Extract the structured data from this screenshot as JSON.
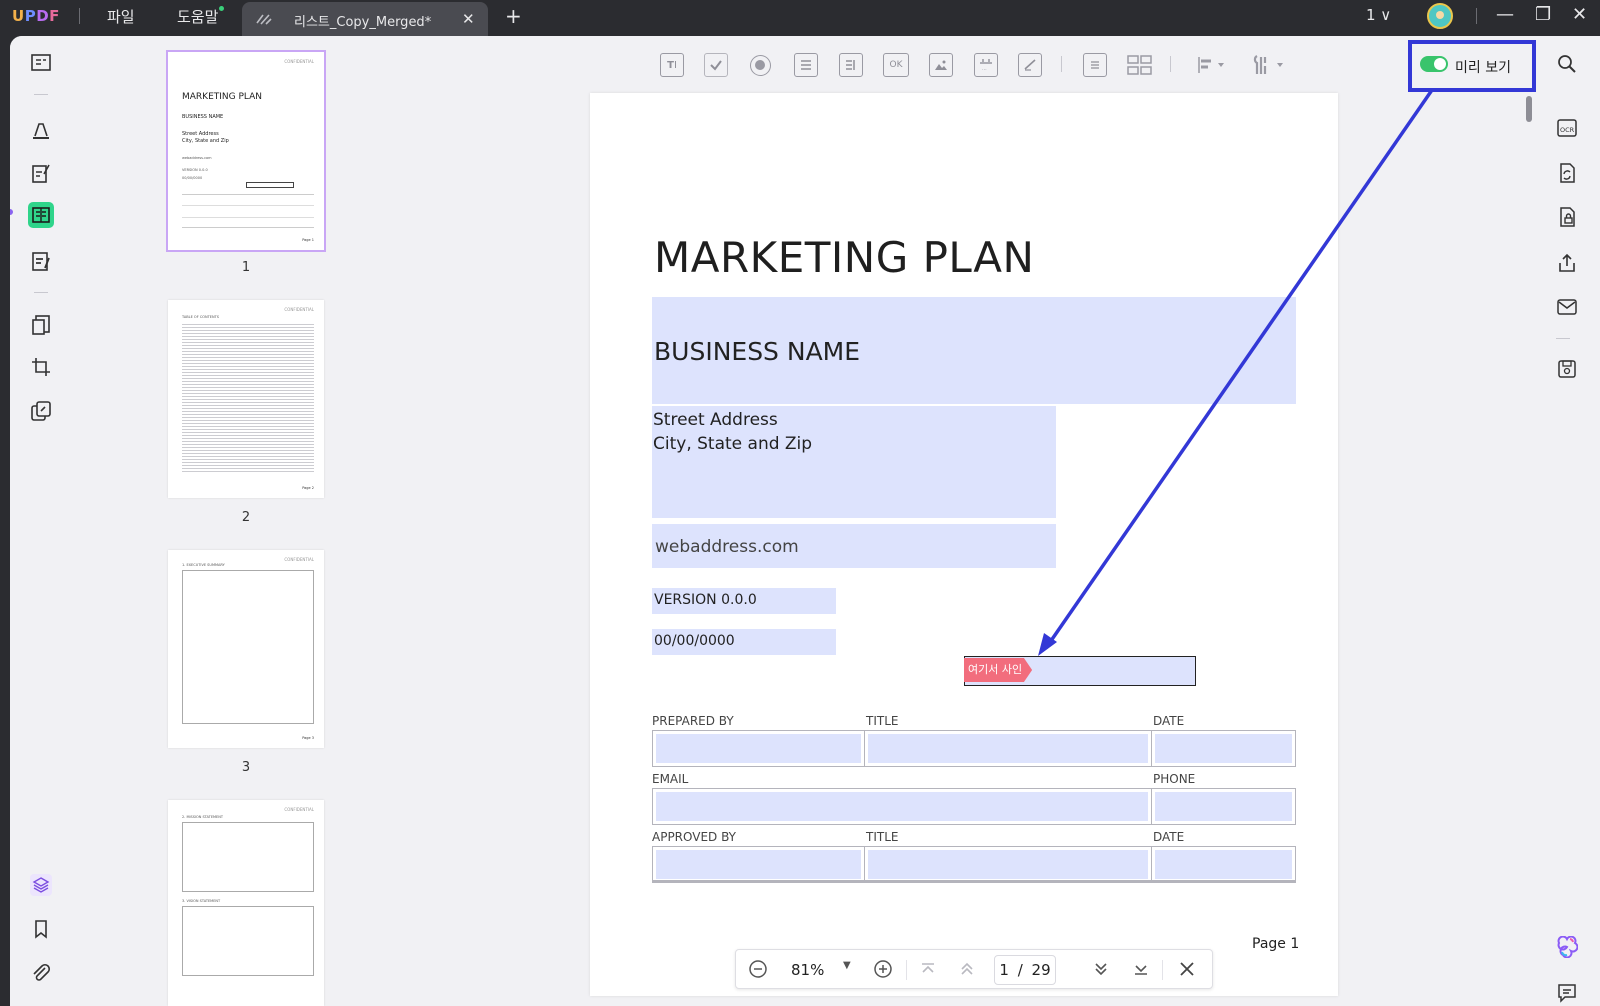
{
  "app": {
    "logo": "UPDF"
  },
  "menus": {
    "file": "파일",
    "help": "도움말"
  },
  "tab": {
    "title": "리스트_Copy_Merged*",
    "close": "✕",
    "add": "+"
  },
  "window": {
    "page_selector": "1 ∨",
    "minimize": "—",
    "restore": "❐",
    "close": "✕"
  },
  "preview": {
    "label": "미리 보기",
    "enabled": true
  },
  "thumbnails": [
    {
      "number": "1",
      "conf": "CONFIDENTIAL",
      "title": "MARKETING PLAN",
      "business": "BUSINESS NAME",
      "addr1": "Street Address",
      "addr2": "City, State and Zip",
      "web": "webaddress.com",
      "version": "VERSION 0.0.0",
      "date": "00/00/0000",
      "page": "Page 1"
    },
    {
      "number": "2",
      "conf": "CONFIDENTIAL",
      "heading": "TABLE OF CONTENTS",
      "page": "Page 2"
    },
    {
      "number": "3",
      "conf": "CONFIDENTIAL",
      "heading": "1. EXECUTIVE SUMMARY",
      "page": "Page 3"
    },
    {
      "number": "4",
      "conf": "CONFIDENTIAL",
      "heading": "2. MISSION STATEMENT",
      "heading2": "3. VISION STATEMENT"
    }
  ],
  "document": {
    "title": "MARKETING PLAN",
    "business_name": "BUSINESS NAME",
    "street": "Street Address",
    "city": "City, State and Zip",
    "web": "webaddress.com",
    "version": "VERSION 0.0.0",
    "date": "00/00/0000",
    "signature_tag": "여기서 사인",
    "labels": {
      "prepared_by": "PREPARED BY",
      "title1": "TITLE",
      "date1": "DATE",
      "email": "EMAIL",
      "phone": "PHONE",
      "approved_by": "APPROVED BY",
      "title2": "TITLE",
      "date2": "DATE"
    },
    "footer": "Page 1"
  },
  "navigation": {
    "zoom": "81%",
    "current_page": "1",
    "separator": "/",
    "total_pages": "29"
  },
  "colors": {
    "field_fill": "#dde3fd",
    "accent_green": "#2fd48a",
    "annotation_blue": "#3338d6",
    "signature_tag": "#f26d7d",
    "toggle_on": "#39c46c"
  }
}
